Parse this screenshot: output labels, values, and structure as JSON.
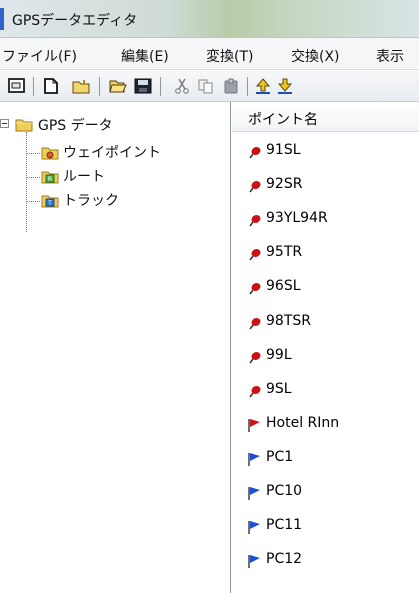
{
  "window": {
    "title": "GPSデータエディタ"
  },
  "menu": [
    "ファイル(F)",
    "編集(E)",
    "変換(T)",
    "交換(X)",
    "表示"
  ],
  "toolbar": {
    "icons": [
      "properties-icon",
      "new-file-icon",
      "new-folder-icon",
      "open-folder-icon",
      "save-icon",
      "cut-icon",
      "copy-icon",
      "paste-icon",
      "upload-icon",
      "download-icon"
    ]
  },
  "tree": {
    "root": "GPS データ",
    "children": [
      "ウェイポイント",
      "ルート",
      "トラック"
    ]
  },
  "list": {
    "column_header": "ポイント名",
    "items": [
      {
        "name": "91SL",
        "marker": "red-pin"
      },
      {
        "name": "92SR",
        "marker": "red-pin"
      },
      {
        "name": "93YL94R",
        "marker": "red-pin"
      },
      {
        "name": "95TR",
        "marker": "red-pin"
      },
      {
        "name": "96SL",
        "marker": "red-pin"
      },
      {
        "name": "98TSR",
        "marker": "red-pin"
      },
      {
        "name": "99L",
        "marker": "red-pin"
      },
      {
        "name": "9SL",
        "marker": "red-pin"
      },
      {
        "name": "Hotel RInn",
        "marker": "red-flag"
      },
      {
        "name": "PC1",
        "marker": "blue-flag"
      },
      {
        "name": "PC10",
        "marker": "blue-flag"
      },
      {
        "name": "PC11",
        "marker": "blue-flag"
      },
      {
        "name": "PC12",
        "marker": "blue-flag"
      }
    ]
  },
  "colors": {
    "pin_red": "#cc1111",
    "flag_blue": "#1f4fd8",
    "flag_red": "#d0121b",
    "folder_yellow": "#f0cf58"
  }
}
